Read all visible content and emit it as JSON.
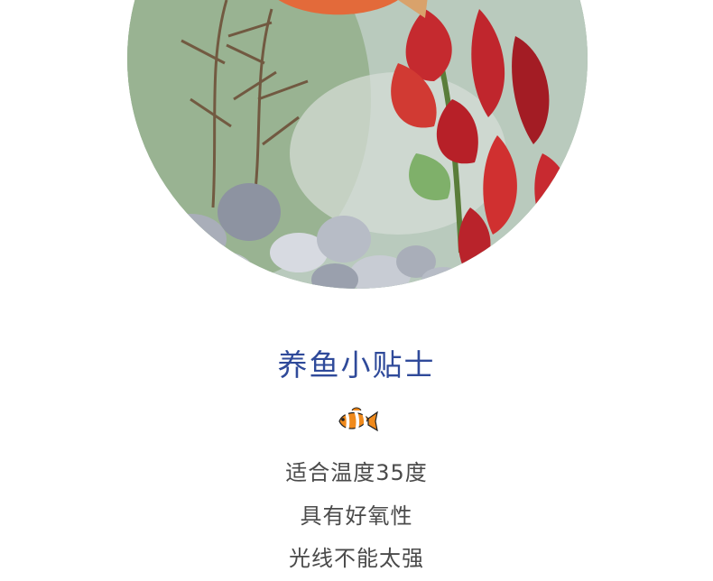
{
  "photo": {
    "subject": "aquarium-fish-plants-pebbles"
  },
  "title": "养鱼小贴士",
  "icon": "clownfish-icon",
  "tips": [
    "适合温度35度",
    "具有好氧性",
    "光线不能太强"
  ],
  "colors": {
    "title": "#2f4a9a",
    "text": "#4a4a4a",
    "background": "#ffffff"
  }
}
